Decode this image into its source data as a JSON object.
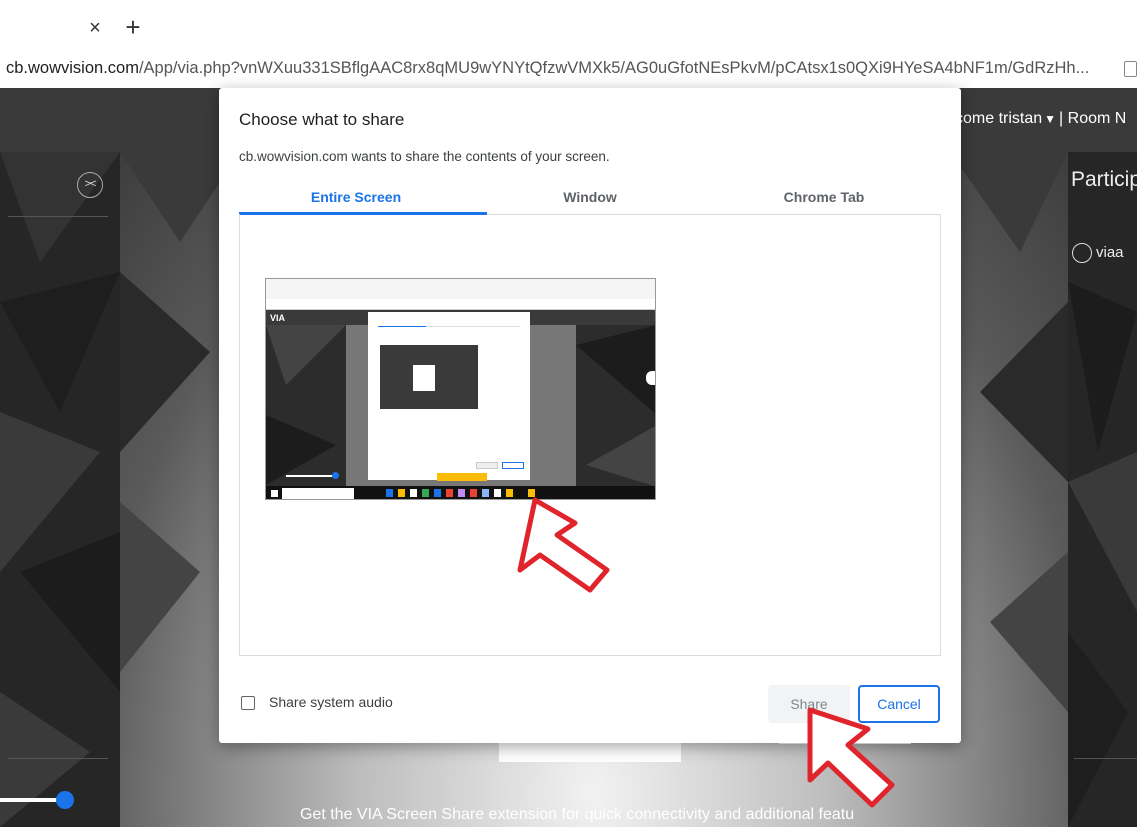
{
  "browser": {
    "tab_close": "×",
    "tab_new": "+",
    "url_host": "cb.wowvision.com",
    "url_path": "/App/via.php?vnWXuu331SBflgAAC8rx8qMU9wYNYtQfzwVMXk5/AG0uGfotNEsPkvM/pCAtsx1s0QXi9HYeSA4bNF1m/GdRzHh..."
  },
  "app": {
    "welcome_prefix": "come",
    "user_name": "tristan",
    "room_label": "| Room N",
    "participants_title": "Particip",
    "participant_name": "viaa",
    "footer_text": "Get the VIA Screen Share extension for quick connectivity and additional featu"
  },
  "dialog": {
    "title": "Choose what to share",
    "subtitle": "cb.wowvision.com wants to share the contents of your screen.",
    "tabs": [
      {
        "label": "Entire Screen",
        "active": true
      },
      {
        "label": "Window",
        "active": false
      },
      {
        "label": "Chrome Tab",
        "active": false
      }
    ],
    "audio_label": "Share system audio",
    "audio_checked": false,
    "share_label": "Share",
    "cancel_label": "Cancel"
  },
  "colors": {
    "accent": "#1a73e8",
    "annotation_arrow": "#e0242c"
  }
}
